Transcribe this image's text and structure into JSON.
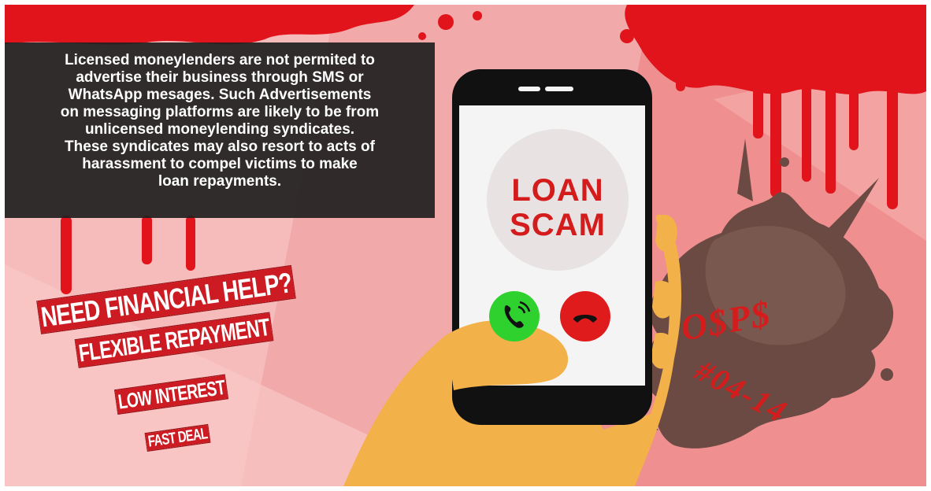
{
  "info": {
    "lines": [
      "Licensed moneylenders are not permited to",
      "advertise their business through SMS or",
      "WhatsApp mesages. Such Advertisements",
      "on messaging platforms are likely to be from",
      "unlicensed moneylending syndicates.",
      "These syndicates may also resort to acts of",
      "harassment to compel victims to make",
      "loan repayments."
    ]
  },
  "promo": {
    "line1": "NEED FINANCIAL HELP?",
    "line2": "FLEXIBLE REPAYMENT",
    "line3": "LOW INTEREST",
    "line4": "FAST DEAL"
  },
  "phone": {
    "screen_line1": "LOAN",
    "screen_line2": "SCAM"
  },
  "signature": {
    "line1": "O$P$",
    "line2": "#04-14"
  },
  "colors": {
    "blood_red": "#e1141c",
    "background_pink": "#f3b0b0",
    "accept_green": "#2fd12f",
    "decline_red": "#e01b1b",
    "hand_skin": "#f3b14a"
  },
  "icons": [
    "phone-accept-icon",
    "phone-decline-icon"
  ]
}
